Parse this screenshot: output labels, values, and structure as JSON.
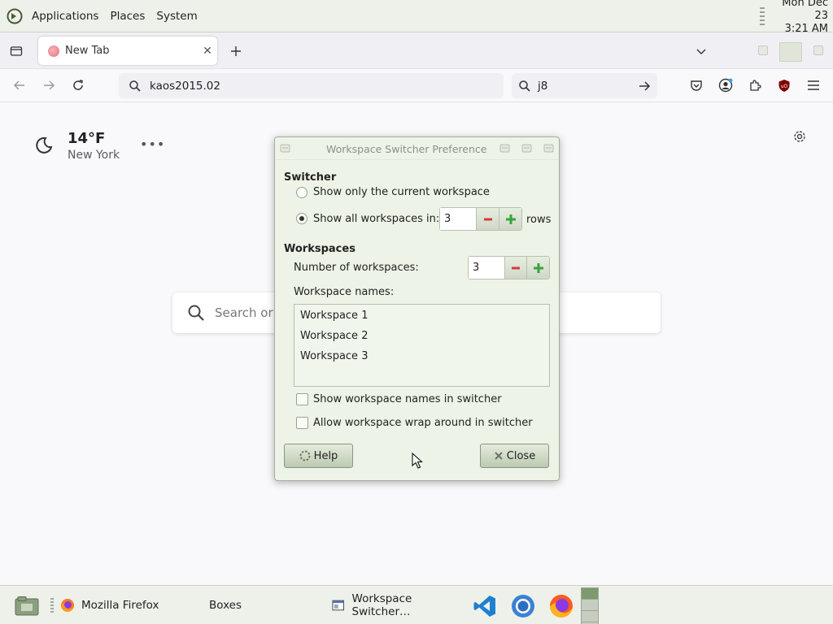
{
  "top_panel": {
    "menus": [
      "Applications",
      "Places",
      "System"
    ],
    "clock_date": "Mon Dec 23",
    "clock_time": "3:21 AM"
  },
  "browser": {
    "tab_title": "New Tab",
    "url": "kaos2015.02",
    "search_text": "j8"
  },
  "weather": {
    "temperature": "14°F",
    "city": "New York"
  },
  "page_search": {
    "placeholder": "Search or e"
  },
  "dialog": {
    "title": "Workspace Switcher Preferences",
    "switcher_heading": "Switcher",
    "show_current_label": "Show only the current workspace",
    "show_all_label": "Show all workspaces in:",
    "rows_value": "3",
    "rows_suffix": "rows",
    "workspaces_heading": "Workspaces",
    "num_workspaces_label": "Number of workspaces:",
    "num_workspaces_value": "3",
    "names_label": "Workspace names:",
    "workspace_names": [
      "Workspace 1",
      "Workspace 2",
      "Workspace 3"
    ],
    "show_names_label": "Show workspace names in switcher",
    "wrap_label": "Allow workspace wrap around in switcher",
    "help_label": "Help",
    "close_label": "Close",
    "selected_option": "show_all"
  },
  "taskbar": {
    "items": [
      "Mozilla Firefox",
      "Boxes",
      "Workspace Switcher…"
    ],
    "workspace_count": 3,
    "active_workspace": 1
  },
  "colors": {
    "panel_bg": "#eef1ea",
    "dialog_bg": "#edf3e6",
    "minus_red": "#d9393a",
    "plus_green": "#3aa33c"
  }
}
